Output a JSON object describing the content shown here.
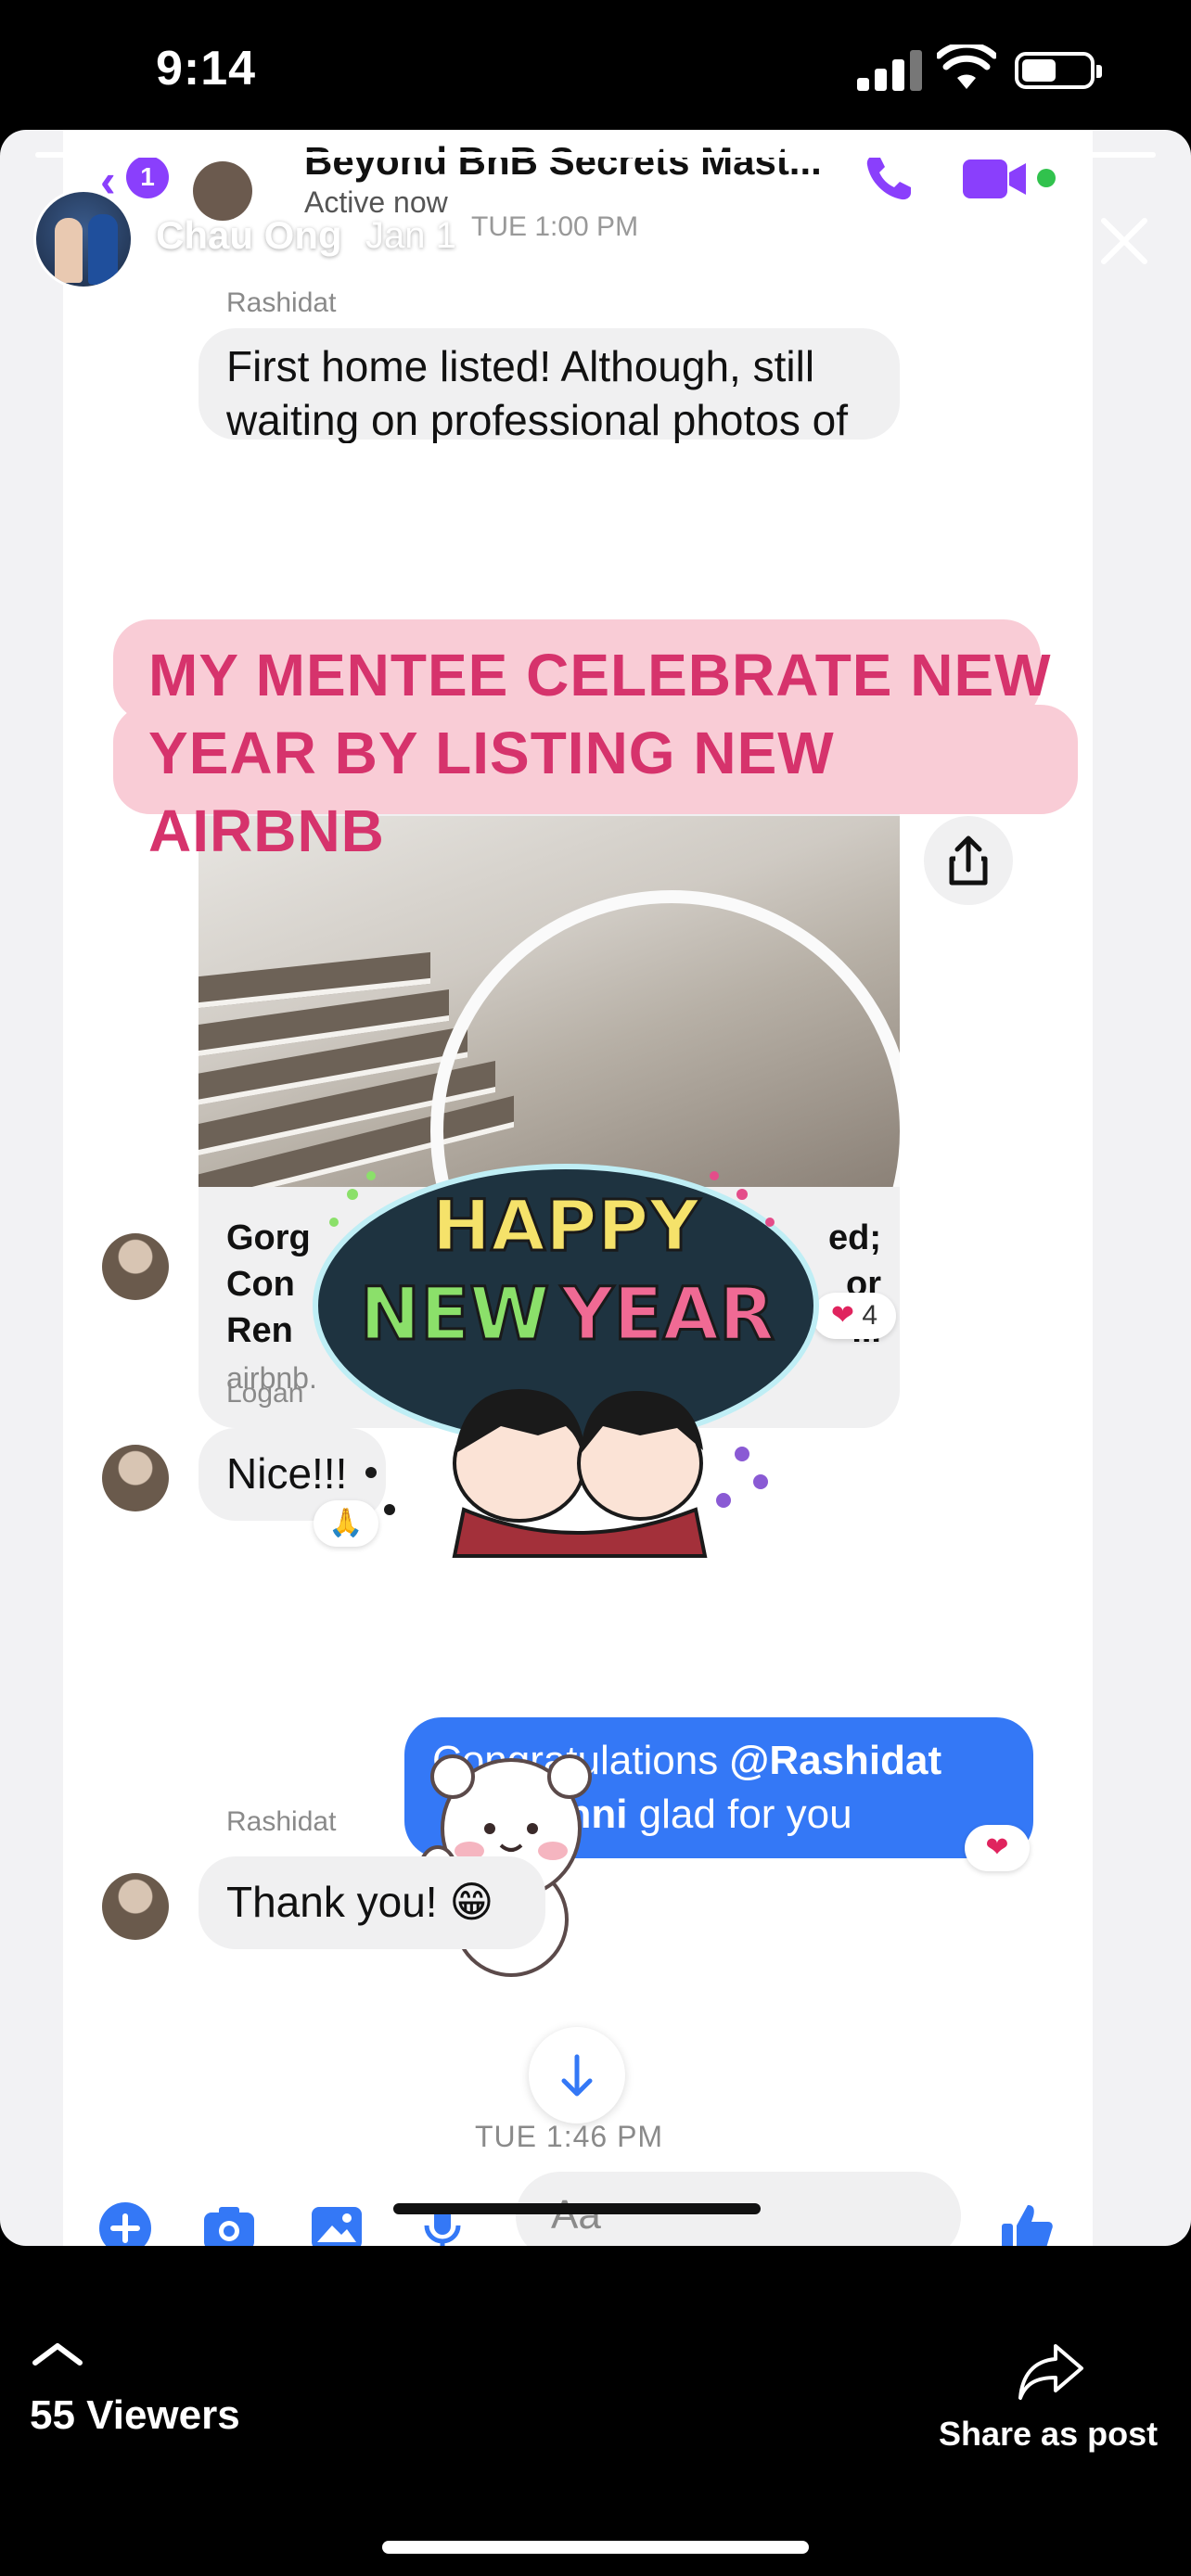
{
  "status_bar": {
    "time": "9:14"
  },
  "story": {
    "user": "Chau Ong",
    "date": "Jan 1"
  },
  "messenger": {
    "back_count": "1",
    "group_name": "Beyond BnB Secrets Mast...",
    "active_status": "Active now",
    "header_timestamp": "TUE 1:00 PM",
    "messages": {
      "m1_sender": "Rashidat",
      "m1_text": "First home listed! Although, still waiting on professional photos of finished product.  https://",
      "link_title_left": "Gorg\nCon\nRen",
      "link_title_right": "ed;\nor\n...",
      "link_domain": "airbnb.",
      "link_reaction": "4",
      "m2_sender": "Logan",
      "m2_text": "Nice!!!",
      "m3_text_prefix": "Congratulations ",
      "m3_mention": "@Rashidat",
      "m3_mention2": "anni",
      "m3_text_suffix": " glad for you",
      "m4_sender": "Rashidat",
      "m4_text": "Thank you! 😁"
    },
    "bottom_timestamp": "TUE 1:46 PM",
    "composer_placeholder": "Aa"
  },
  "overlay": {
    "banner_line1": "MY MENTEE CELEBRATE NEW",
    "banner_line2": "YEAR BY LISTING NEW AIRBNB",
    "sticker_line1": "HAPPY",
    "sticker_line2a": "NEW",
    "sticker_line2b": "YEAR"
  },
  "footer": {
    "viewers": "55 Viewers",
    "share_label": "Share as post"
  },
  "colors": {
    "messenger_accent": "#8a3ffc",
    "bubble_blue": "#3478f6",
    "banner_bg": "#f9ccd6",
    "banner_text": "#d6336c"
  },
  "icons": [
    "signal-icon",
    "wifi-icon",
    "battery-icon",
    "back-chevron-icon",
    "phone-icon",
    "video-icon",
    "more-icon",
    "close-icon",
    "share-icon",
    "heart-icon",
    "pray-icon",
    "arrow-down-icon",
    "plus-icon",
    "camera-icon",
    "image-icon",
    "mic-icon",
    "emoji-icon",
    "like-icon",
    "chevron-up-icon"
  ]
}
